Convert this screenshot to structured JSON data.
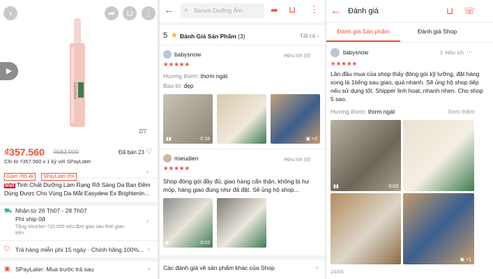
{
  "product_panel": {
    "page_counter": "2/7",
    "price_current": "₫357.560",
    "price_original": "₫682.000",
    "sold": "Đã bán 23",
    "installment": "Chỉ từ ₫357.560 x 1 kỳ với SPayLater",
    "voucher_tag": "Giảm ₫65,4k",
    "spaylater_tag": "SPayLater 0%",
    "mall_badge": "Mall",
    "title": "Tinh Chất Dưỡng Làm Rạng Rỡ Sáng Da Ban Đêm Dùng Được Cho Vùng Da Mắt Easydew Ex Brightenin...",
    "delivery_dates": "Nhận từ 26 Th07 - 28 Th07",
    "shipping_fee": "Phí ship 0đ",
    "voucher_note": "Tặng Voucher ₫15.000 nếu đơn giao sau thời gian trên.",
    "return_policy": "Trả hàng miễn phí 15 ngày · Chính hãng 100%...",
    "spaylater_row": "SPayLater: Mua trước trả sau",
    "product_brand_text": "Easydew"
  },
  "reviews_panel": {
    "search_placeholder": "Serum Dưỡng Ẩm",
    "rating_value": "5",
    "section_title": "Đánh Giá Sản Phẩm",
    "review_count": "(3)",
    "see_all": "Tất cả",
    "reviews": [
      {
        "user": "babysnow",
        "helpful": "Hữu ích (0)",
        "stars": "★★★★★",
        "attr1_label": "Hương thơm:",
        "attr1_value": "thơm ngát",
        "attr2_label": "Bao bì:",
        "attr2_value": "đẹp",
        "video_duration": "0:18",
        "more_photos": "+2"
      },
      {
        "user": "mieudien",
        "helpful": "Hữu ích (0)",
        "stars": "★★★★★",
        "text": "Shop đóng gói đầy đủ, giao hàng cẩn thận, không bị hư móp, hàng giao đúng như đã đặt. Sẽ ủng hộ shop...",
        "video_duration": "0:03"
      }
    ],
    "other_reviews": "Các đánh giá về sản phẩm khác của Shop"
  },
  "detail_panel": {
    "header_title": "Đánh giá",
    "tab_product": "Đánh giá Sản phẩm",
    "tab_shop": "Đánh giá Shop",
    "user": "babysnow",
    "helpful": "Hữu ích",
    "stars": "★★★★★",
    "review_text": "Lần đầu mua của shop thấy đóng gói kỹ lưỡng, đặt hàng xong là 1tiếng sau giao, quá nhanh. Sẽ ủng hộ shop tiếp nếu sử dụng tốt. Shipper linh hoạt, nhanh nhẹn. Cho shop 5 sao.",
    "attr_label": "Hương thơm:",
    "attr_value": "thơm ngát",
    "see_more": "Xem thêm",
    "video_duration": "0:03",
    "more_photos": "+1",
    "date": "24/06"
  },
  "colors": {
    "accent": "#ee4d2d",
    "product_pink": "#f2c6c1"
  }
}
